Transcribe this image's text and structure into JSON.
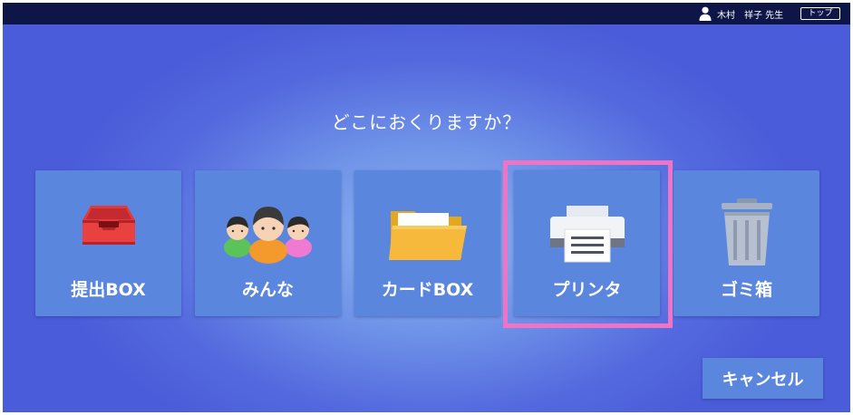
{
  "header": {
    "user_name": "木村　祥子 先生",
    "top_button_label": "トップ"
  },
  "prompt": {
    "question": "どこにおくりますか？"
  },
  "destinations": [
    {
      "label": "提出BOX",
      "icon": "inbox-tray-icon"
    },
    {
      "label": "みんな",
      "icon": "people-group-icon"
    },
    {
      "label": "カードBOX",
      "icon": "folder-icon"
    },
    {
      "label": "プリンタ",
      "icon": "printer-icon",
      "selected": true
    },
    {
      "label": "ゴミ箱",
      "icon": "trash-can-icon"
    }
  ],
  "footer": {
    "cancel_label": "キャンセル"
  },
  "colors": {
    "top_bar": "#0e1547",
    "tile": "#5b86dd",
    "selection_highlight": "#f074c6"
  }
}
